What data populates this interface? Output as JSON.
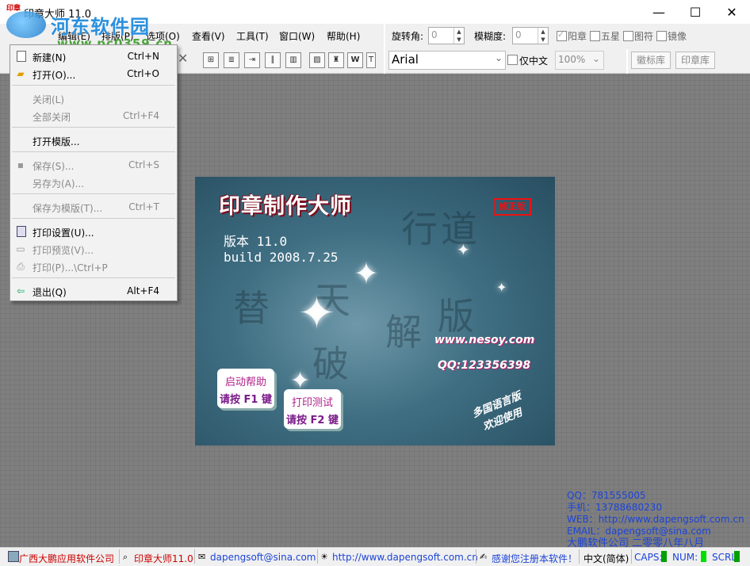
{
  "window": {
    "title": "印章大师 11.0",
    "icon_text": "印章",
    "buttons": {
      "minimize": "—",
      "maximize": "☐",
      "close": "✕"
    }
  },
  "watermark": {
    "site_name": "河东软件园",
    "url": "www.pc0359.cn"
  },
  "menubar": {
    "items": [
      {
        "label": "编辑(E)"
      },
      {
        "label": "排版(P)"
      },
      {
        "label": "选项(O)"
      },
      {
        "label": "查看(V)"
      },
      {
        "label": "工具(T)"
      },
      {
        "label": "窗口(W)"
      },
      {
        "label": "帮助(H)"
      }
    ]
  },
  "rotate_bar": {
    "rotate_label": "旋转角:",
    "rotate_value": "0",
    "blur_label": "模糊度:",
    "blur_value": "0",
    "checkboxes": [
      {
        "label": "阳章",
        "checked": true
      },
      {
        "label": "五星",
        "checked": false
      },
      {
        "label": "图符",
        "checked": false
      },
      {
        "label": "镜像",
        "checked": false
      }
    ]
  },
  "font_bar": {
    "font": "Arial",
    "only_chinese_label": "仅中文",
    "zoom": "100%"
  },
  "library_tabs": [
    "徽标库",
    "印章库"
  ],
  "file_menu": {
    "items": [
      {
        "label": "新建(N)",
        "shortcut": "Ctrl+N",
        "disabled": false,
        "icon": "new-icon"
      },
      {
        "label": "打开(O)...",
        "shortcut": "Ctrl+O",
        "disabled": false,
        "icon": "open-folder-icon"
      },
      {
        "label": "关闭(L)",
        "shortcut": "",
        "disabled": true
      },
      {
        "label": "全部关闭",
        "shortcut": "Ctrl+F4",
        "disabled": true
      },
      {
        "label": "打开模版...",
        "shortcut": "",
        "disabled": false
      },
      {
        "label": "保存(S)...",
        "shortcut": "Ctrl+S",
        "disabled": true,
        "icon": "save-icon"
      },
      {
        "label": "另存为(A)...",
        "shortcut": "",
        "disabled": true
      },
      {
        "label": "保存为模版(T)...",
        "shortcut": "Ctrl+T",
        "disabled": true
      },
      {
        "label": "打印设置(U)...",
        "shortcut": "",
        "disabled": false,
        "icon": "print-setup-icon"
      },
      {
        "label": "打印预览(V)...",
        "shortcut": "",
        "disabled": true,
        "icon": "print-preview-icon"
      },
      {
        "label": "打印(P)...\\Ctrl+P",
        "shortcut": "",
        "disabled": true,
        "icon": "print-icon"
      },
      {
        "label": "退出(Q)",
        "shortcut": "Alt+F4",
        "disabled": false,
        "icon": "exit-icon"
      }
    ]
  },
  "splash": {
    "title": "印章制作大师",
    "badge": "修正版",
    "version": "版本 11.0",
    "build": "build 2008.7.25",
    "calligraphy": [
      "替",
      "天",
      "行",
      "道",
      "破",
      "解",
      "版"
    ],
    "website": "www.nesoy.com",
    "qq": "QQ:123356398",
    "help_button": {
      "line1": "启动帮助",
      "line2": "请按 F1 键"
    },
    "print_button": {
      "line1": "打印测试",
      "line2": "请按 F2 键"
    },
    "multilang": [
      "多国语言版",
      "欢迎使用"
    ]
  },
  "contact": {
    "qq": "QQ：781555005",
    "phone": "手机：13788680230",
    "web": "WEB：http://www.dapengsoft.com.cn",
    "email": "EMAIL：dapengsoft@sina.com",
    "company": "大鹏软件公司  二零零八年八月"
  },
  "statusbar": {
    "company": "广西大鹏应用软件公司",
    "product": "印章大师11.0",
    "email": "dapengsoft@sina.com",
    "url": "http://www.dapengsoft.com.cn",
    "thanks": "感谢您注册本软件！",
    "ime": "中文(简体)",
    "caps": "CAPS:",
    "num": "NUM:",
    "scroll": "SCRL:",
    "colors": {
      "company": "#cc0000",
      "product": "#cc0000",
      "email": "#1c44d8",
      "url": "#1c44d8",
      "thanks": "#1c44d8",
      "indicator": "#00a000"
    }
  }
}
